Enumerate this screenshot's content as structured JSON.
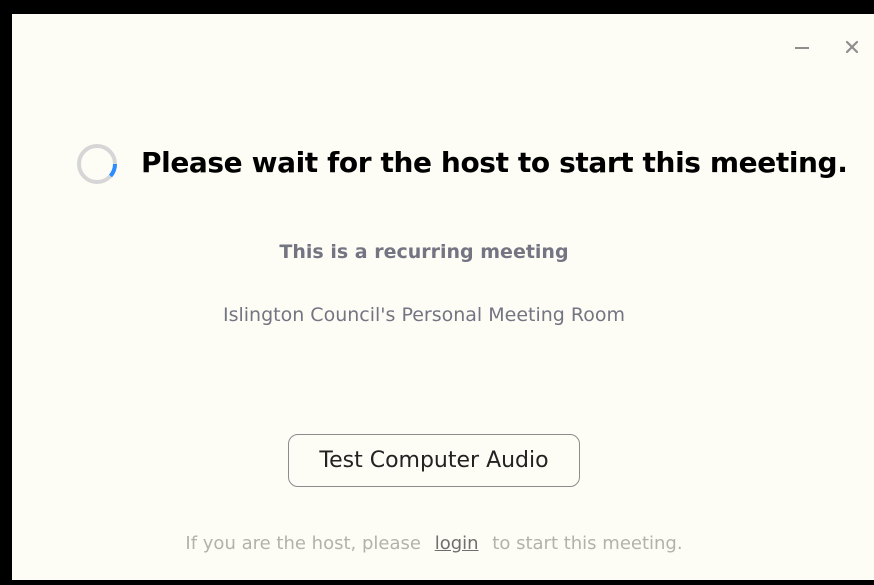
{
  "window": {
    "minimize_icon": "minimize-icon",
    "close_icon": "close-icon"
  },
  "status": {
    "spinner_icon": "loading-spinner-icon",
    "headline": "Please wait for the host to start this meeting."
  },
  "meeting": {
    "type_label": "This is a recurring meeting",
    "room_name": "Islington Council's Personal Meeting Room"
  },
  "actions": {
    "test_audio_label": "Test Computer Audio"
  },
  "footer": {
    "prefix": "If you are the host, please",
    "login_link": "login",
    "suffix": "to start this meeting."
  },
  "colors": {
    "background": "#fdfdf6",
    "spinner_track": "#d6d6d6",
    "spinner_accent": "#2d8cff",
    "muted_text": "#747482"
  }
}
